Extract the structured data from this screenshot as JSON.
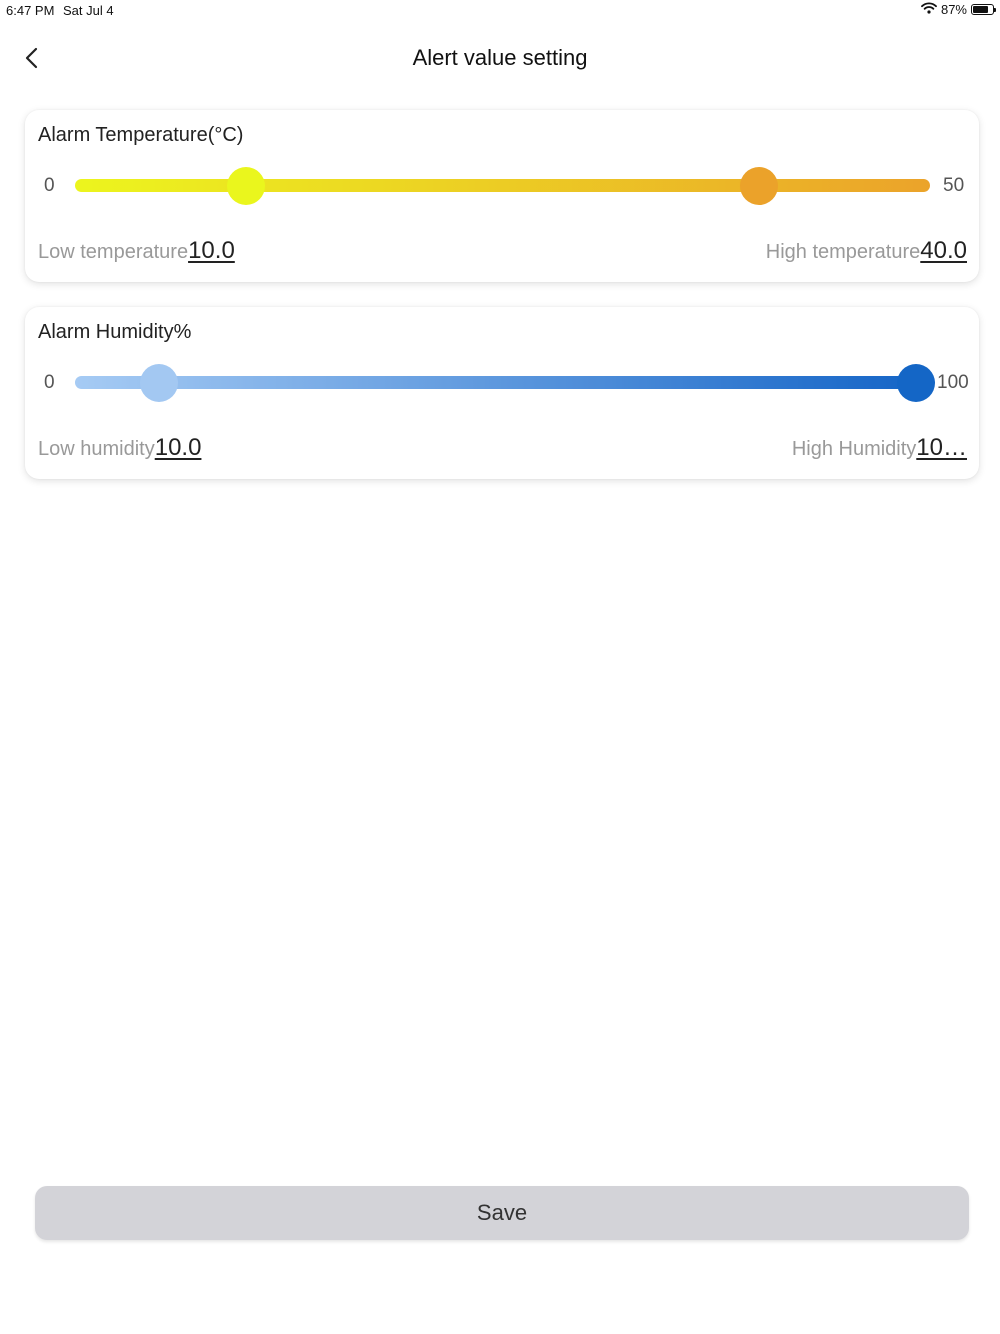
{
  "status_bar": {
    "time": "6:47 PM",
    "date": "Sat Jul 4",
    "battery": "87%"
  },
  "header": {
    "title": "Alert value setting",
    "back_icon": "chevron-left-icon"
  },
  "temperature": {
    "title": "Alarm Temperature(°C)",
    "min_label": "0",
    "max_label": "50",
    "low_label": "Low temperature",
    "low_value": "10.0",
    "high_label": "High temperature",
    "high_value": "40.0",
    "range_min": 0,
    "range_max": 50,
    "low": 10.0,
    "high": 40.0,
    "colors": {
      "start": "#ecf51e",
      "end": "#eba32a",
      "low_thumb": "#eaf61d",
      "high_thumb": "#eba22a"
    }
  },
  "humidity": {
    "title": "Alarm Humidity%",
    "min_label": "0",
    "max_label": "100",
    "low_label": "Low humidity",
    "low_value": "10.0",
    "high_label": "High Humidity",
    "high_value": "10…",
    "range_min": 0,
    "range_max": 100,
    "low": 10.0,
    "high": 100.0,
    "colors": {
      "start": "#a6cbf4",
      "end": "#1565c7",
      "low_thumb": "#a3c8f2",
      "high_thumb": "#1466c6"
    }
  },
  "save_label": "Save"
}
